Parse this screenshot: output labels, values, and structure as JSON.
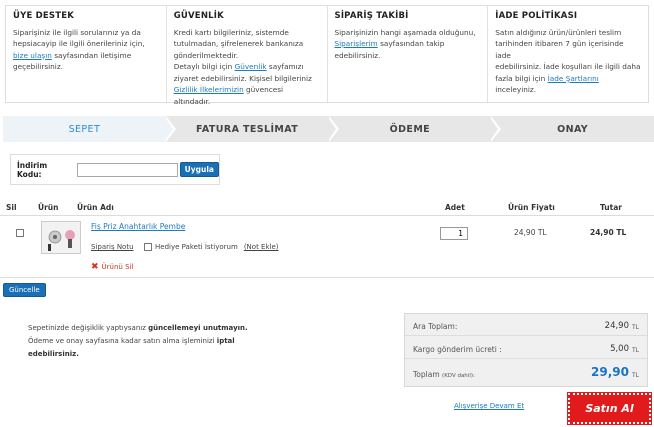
{
  "info": [
    {
      "title": "ÜYE DESTEK",
      "lines": [
        "Siparişiniz ile ilgili sorularınız ya da",
        "hepsiacayip ile ilgili önerileriniz için,"
      ],
      "link": "bize ulaşın",
      "after": "sayfasından iletişime",
      "tail": "geçebilirsiniz."
    },
    {
      "title": "GÜVENLİK",
      "lines": [
        "Kredi kartı bilgileriniz, sistemde",
        "tutulmadan, şifrelenerek bankanıza",
        "gönderilmektedir."
      ],
      "p2_pre": "Detaylı bilgi için",
      "p2_link": "Güvenlik",
      "p2_post": "sayfamızı",
      "p2_line2": "ziyaret edebilirsiniz. Kişisel bilgileriniz",
      "p2_link2": "Gizlilik İlkelerimizin",
      "p2_post2": "güvencesi altındadır."
    },
    {
      "title": "SİPARİŞ TAKİBİ",
      "line1": "Siparişinizin hangi aşamada olduğunu,",
      "link": "Siparişlerim",
      "after": "sayfasından takip",
      "tail": "edebilirsiniz."
    },
    {
      "title": "İADE POLİTİKASI",
      "lines": [
        "Satın aldığınız ürün/ürünleri teslim",
        "tarihinden itibaren 7 gün içerisinde iade",
        "edebilirsiniz. İade koşulları ile ilgili daha"
      ],
      "pre": "fazla bilgi için",
      "link": "İade Şartlarını",
      "after": "inceleyiniz."
    }
  ],
  "steps": [
    "SEPET",
    "FATURA TESLİMAT",
    "ÖDEME",
    "ONAY"
  ],
  "coupon": {
    "label": "İndirim Kodu:",
    "value": "",
    "button": "Uygula"
  },
  "table": {
    "headers": {
      "sil": "Sil",
      "urun": "Ürün",
      "urun_adi": "Ürün Adı",
      "adet": "Adet",
      "fiyat": "Ürün Fiyatı",
      "tutar": "Tutar"
    },
    "row": {
      "name": "Fiş Priz Anahtarlık Pembe",
      "note": "Sipariş Notu",
      "gift": "Hediye Paketi İstiyorum",
      "gift_note": "(Not Ekle)",
      "remove": "Ürünü Sil",
      "qty": "1",
      "price": "24,90 TL",
      "total": "24,90 TL"
    }
  },
  "update_button": "Güncelle",
  "notes": {
    "l1_pre": "Sepetinizde değişiklik yaptıysanız",
    "l1_bold": "güncellemeyi unutmayın.",
    "l2_pre": "Ödeme ve onay sayfasına kadar satın alma işleminizi",
    "l2_bold1": "iptal",
    "l3_bold": "edebilirsiniz."
  },
  "summary": {
    "subtotal_label": "Ara Toplam:",
    "subtotal": "24,90",
    "shipping_label": "Kargo gönderim ücreti :",
    "shipping": "5,00",
    "total_label": "Toplam",
    "total_note": "(KDV dahil):",
    "total": "29,90",
    "currency": "TL"
  },
  "continue": "Alışverişe Devam Et",
  "buy": "Satın Al"
}
